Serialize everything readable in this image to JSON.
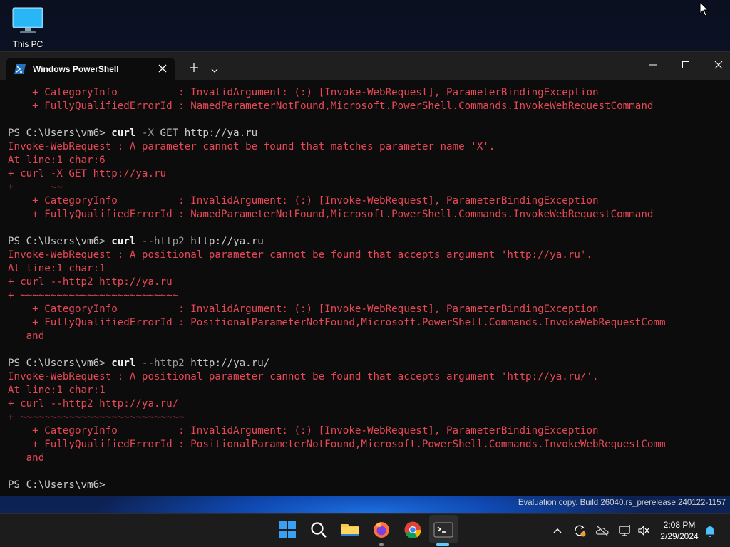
{
  "desktop": {
    "icons": [
      {
        "label": "This PC",
        "icon": "monitor-icon"
      }
    ]
  },
  "window": {
    "tab_title": "Windows PowerShell",
    "tab_icon": "powershell-icon",
    "new_tab_icon": "plus-icon",
    "dropdown_icon": "chevron-down-icon",
    "controls": [
      "minimize-icon",
      "maximize-icon",
      "close-icon"
    ]
  },
  "terminal": {
    "lines": [
      [
        {
          "t": "    + CategoryInfo          : InvalidArgument: (:) [Invoke-WebRequest], ParameterBindingException",
          "c": "err"
        }
      ],
      [
        {
          "t": "    + FullyQualifiedErrorId : NamedParameterNotFound,Microsoft.PowerShell.Commands.InvokeWebRequestCommand",
          "c": "err"
        }
      ],
      [
        {
          "t": "",
          "c": "prompt"
        }
      ],
      [
        {
          "t": "PS C:\\Users\\vm6> ",
          "c": "prompt"
        },
        {
          "t": "curl",
          "c": "cmd"
        },
        {
          "t": " -X",
          "c": "param"
        },
        {
          "t": " GET http://ya.ru",
          "c": "prompt"
        }
      ],
      [
        {
          "t": "Invoke-WebRequest : A parameter cannot be found that matches parameter name 'X'.",
          "c": "err"
        }
      ],
      [
        {
          "t": "At line:1 char:6",
          "c": "err"
        }
      ],
      [
        {
          "t": "+ curl -X GET http://ya.ru",
          "c": "err"
        }
      ],
      [
        {
          "t": "+      ~~",
          "c": "err"
        }
      ],
      [
        {
          "t": "    + CategoryInfo          : InvalidArgument: (:) [Invoke-WebRequest], ParameterBindingException",
          "c": "err"
        }
      ],
      [
        {
          "t": "    + FullyQualifiedErrorId : NamedParameterNotFound,Microsoft.PowerShell.Commands.InvokeWebRequestCommand",
          "c": "err"
        }
      ],
      [
        {
          "t": "",
          "c": "prompt"
        }
      ],
      [
        {
          "t": "PS C:\\Users\\vm6> ",
          "c": "prompt"
        },
        {
          "t": "curl",
          "c": "cmd"
        },
        {
          "t": " --http2",
          "c": "param"
        },
        {
          "t": " http://ya.ru",
          "c": "prompt"
        }
      ],
      [
        {
          "t": "Invoke-WebRequest : A positional parameter cannot be found that accepts argument 'http://ya.ru'.",
          "c": "err"
        }
      ],
      [
        {
          "t": "At line:1 char:1",
          "c": "err"
        }
      ],
      [
        {
          "t": "+ curl --http2 http://ya.ru",
          "c": "err"
        }
      ],
      [
        {
          "t": "+ ~~~~~~~~~~~~~~~~~~~~~~~~~~",
          "c": "err"
        }
      ],
      [
        {
          "t": "    + CategoryInfo          : InvalidArgument: (:) [Invoke-WebRequest], ParameterBindingException",
          "c": "err"
        }
      ],
      [
        {
          "t": "    + FullyQualifiedErrorId : PositionalParameterNotFound,Microsoft.PowerShell.Commands.InvokeWebRequestComm",
          "c": "err"
        }
      ],
      [
        {
          "t": "   and",
          "c": "err"
        }
      ],
      [
        {
          "t": "",
          "c": "prompt"
        }
      ],
      [
        {
          "t": "PS C:\\Users\\vm6> ",
          "c": "prompt"
        },
        {
          "t": "curl",
          "c": "cmd"
        },
        {
          "t": " --http2",
          "c": "param"
        },
        {
          "t": " http://ya.ru/",
          "c": "prompt"
        }
      ],
      [
        {
          "t": "Invoke-WebRequest : A positional parameter cannot be found that accepts argument 'http://ya.ru/'.",
          "c": "err"
        }
      ],
      [
        {
          "t": "At line:1 char:1",
          "c": "err"
        }
      ],
      [
        {
          "t": "+ curl --http2 http://ya.ru/",
          "c": "err"
        }
      ],
      [
        {
          "t": "+ ~~~~~~~~~~~~~~~~~~~~~~~~~~~",
          "c": "err"
        }
      ],
      [
        {
          "t": "    + CategoryInfo          : InvalidArgument: (:) [Invoke-WebRequest], ParameterBindingException",
          "c": "err"
        }
      ],
      [
        {
          "t": "    + FullyQualifiedErrorId : PositionalParameterNotFound,Microsoft.PowerShell.Commands.InvokeWebRequestComm",
          "c": "err"
        }
      ],
      [
        {
          "t": "   and",
          "c": "err"
        }
      ],
      [
        {
          "t": "",
          "c": "prompt"
        }
      ],
      [
        {
          "t": "PS C:\\Users\\vm6> ",
          "c": "prompt"
        }
      ]
    ]
  },
  "watermark": "Evaluation copy. Build 26040.rs_prerelease.240122-1157",
  "taskbar": {
    "apps": [
      {
        "name": "start-icon"
      },
      {
        "name": "search-icon"
      },
      {
        "name": "file-explorer-icon"
      },
      {
        "name": "firefox-icon"
      },
      {
        "name": "chrome-icon"
      },
      {
        "name": "terminal-icon"
      }
    ],
    "tray": [
      "chevron-up-icon",
      "sync-icon",
      "onedrive-icon",
      "network-icon",
      "volume-muted-icon",
      "notification-bell-icon"
    ],
    "time": "2:08 PM",
    "date": "2/29/2024"
  },
  "colors": {
    "error": "#e74856",
    "terminal_bg": "#0c0c0c",
    "titlebar_bg": "#1f1f1f",
    "taskbar_bg": "#1c1c1c",
    "accent": "#3a96dd"
  }
}
